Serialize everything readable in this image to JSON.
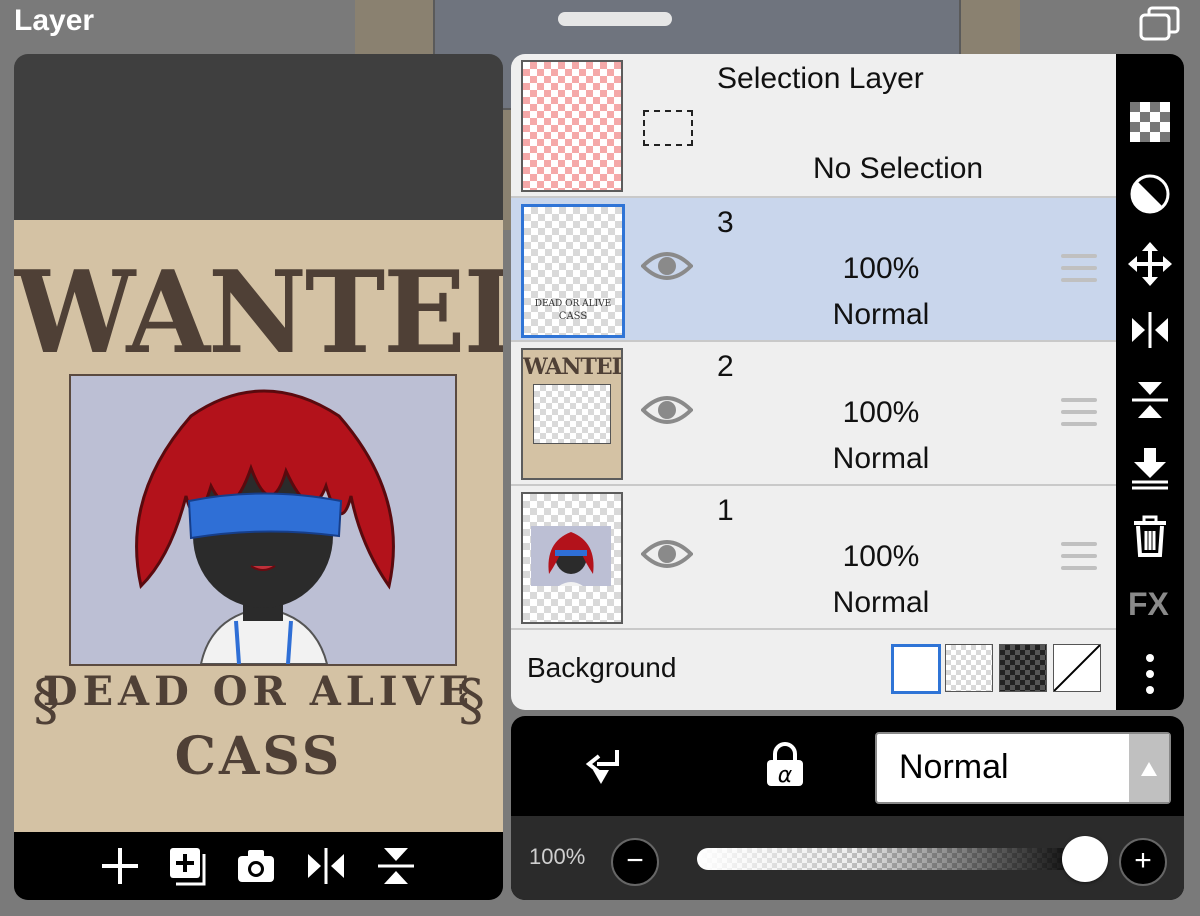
{
  "window": {
    "title": "Layer"
  },
  "canvas": {
    "background_text": "DE",
    "poster": {
      "title": "WANTED",
      "subtitle": "DEAD OR ALIVE",
      "name": "CASS"
    }
  },
  "layers": [
    {
      "name": "Selection Layer",
      "status": "No Selection"
    },
    {
      "name": "3",
      "opacity": "100%",
      "blend": "Normal",
      "selected": true,
      "visible": true,
      "thumb_text": [
        "DEAD OR ALIVE",
        "CASS"
      ]
    },
    {
      "name": "2",
      "opacity": "100%",
      "blend": "Normal",
      "selected": false,
      "visible": true,
      "thumb_text": [
        "WANTED"
      ]
    },
    {
      "name": "1",
      "opacity": "100%",
      "blend": "Normal",
      "selected": false,
      "visible": true
    }
  ],
  "background": {
    "label": "Background",
    "options": [
      "white",
      "checker-light",
      "checker-dark",
      "none"
    ],
    "selected": "white"
  },
  "sidebar": {
    "icons": [
      "checker-icon",
      "invert-icon",
      "move-icon",
      "flip-horizontal-icon",
      "flip-vertical-icon",
      "merge-down-icon",
      "trash-icon"
    ],
    "fx_label": "FX"
  },
  "bottom": {
    "blend_mode": "Normal",
    "opacity_label": "100%",
    "opacity_value": 1.0,
    "minus": "−",
    "plus": "+"
  },
  "colors": {
    "selected_row": "#c9d6ec",
    "active_border": "#2f74d6",
    "panel_bg": "#efefef",
    "poster_bg": "#d4c2a4",
    "hair": "#b3121b",
    "blindfold": "#2f6fd6"
  }
}
